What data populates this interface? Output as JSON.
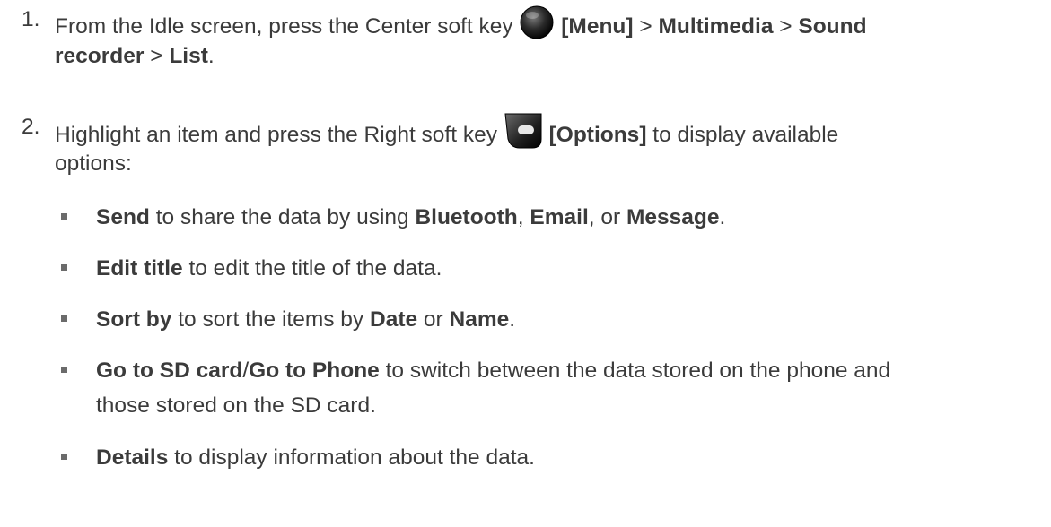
{
  "steps": [
    {
      "number": "1.",
      "line1": {
        "t1": "From the Idle screen, press the Center soft key ",
        "icon": "center-soft-key-icon",
        "b1": "[Menu]",
        "t2": " > ",
        "b2": "Multimedia",
        "t3": " > ",
        "b3": "Sound"
      },
      "line2": {
        "b1": "recorder",
        "t1": " > ",
        "b2": "List",
        "t2": "."
      }
    },
    {
      "number": "2.",
      "line1": {
        "t1": "Highlight an item and press the Right soft key ",
        "icon": "right-soft-key-icon",
        "b1": "[Options]",
        "t2": " to display available"
      },
      "line2": {
        "t1": "options:"
      }
    }
  ],
  "options": [
    {
      "b1": "Send",
      "t1": " to share the data by using ",
      "b2": "Bluetooth",
      "t2": ", ",
      "b3": "Email",
      "t3": ", or ",
      "b4": "Message",
      "t4": "."
    },
    {
      "b1": "Edit title",
      "t1": " to edit the title of the data."
    },
    {
      "b1": "Sort by",
      "t1": " to sort the items by ",
      "b2": "Date",
      "t2": " or ",
      "b3": "Name",
      "t3": "."
    },
    {
      "b1": "Go to SD card",
      "t1": "/",
      "b2": "Go to Phone",
      "t2": " to switch between the data stored on the phone and",
      "line2": "those stored on the SD card."
    },
    {
      "b1": "Details",
      "t1": " to display information about the data."
    }
  ],
  "colors": {
    "text": "#3b3b3b",
    "bullet": "#6b6b6b"
  }
}
